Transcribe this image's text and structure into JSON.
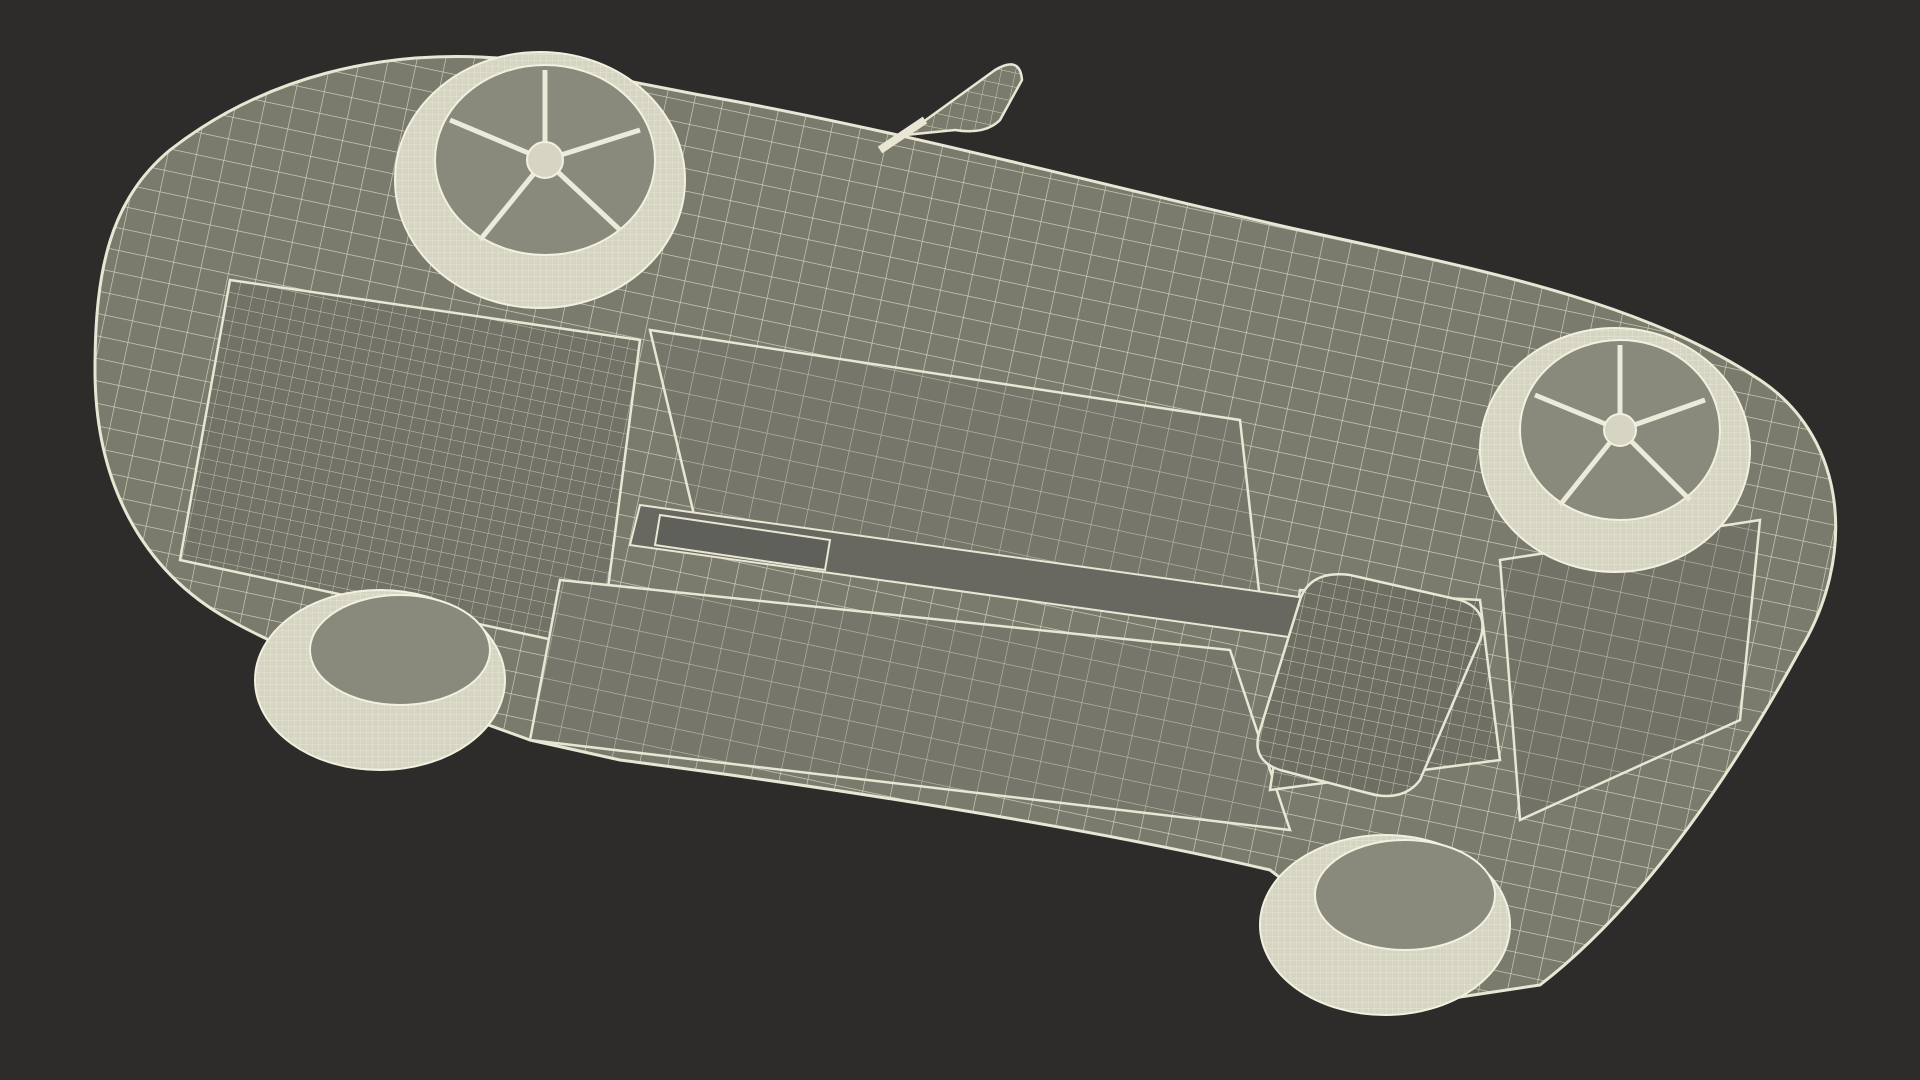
{
  "scene": {
    "subject_icon": "car-wireframe-icon",
    "colors": {
      "background": "#2e2c2b",
      "body_fill": "#7d7d6f",
      "body_fill_dark": "#6d6d60",
      "wire": "#e9e7d4",
      "tire": "#d8d6c4",
      "rim": "#c9c7b4"
    }
  }
}
